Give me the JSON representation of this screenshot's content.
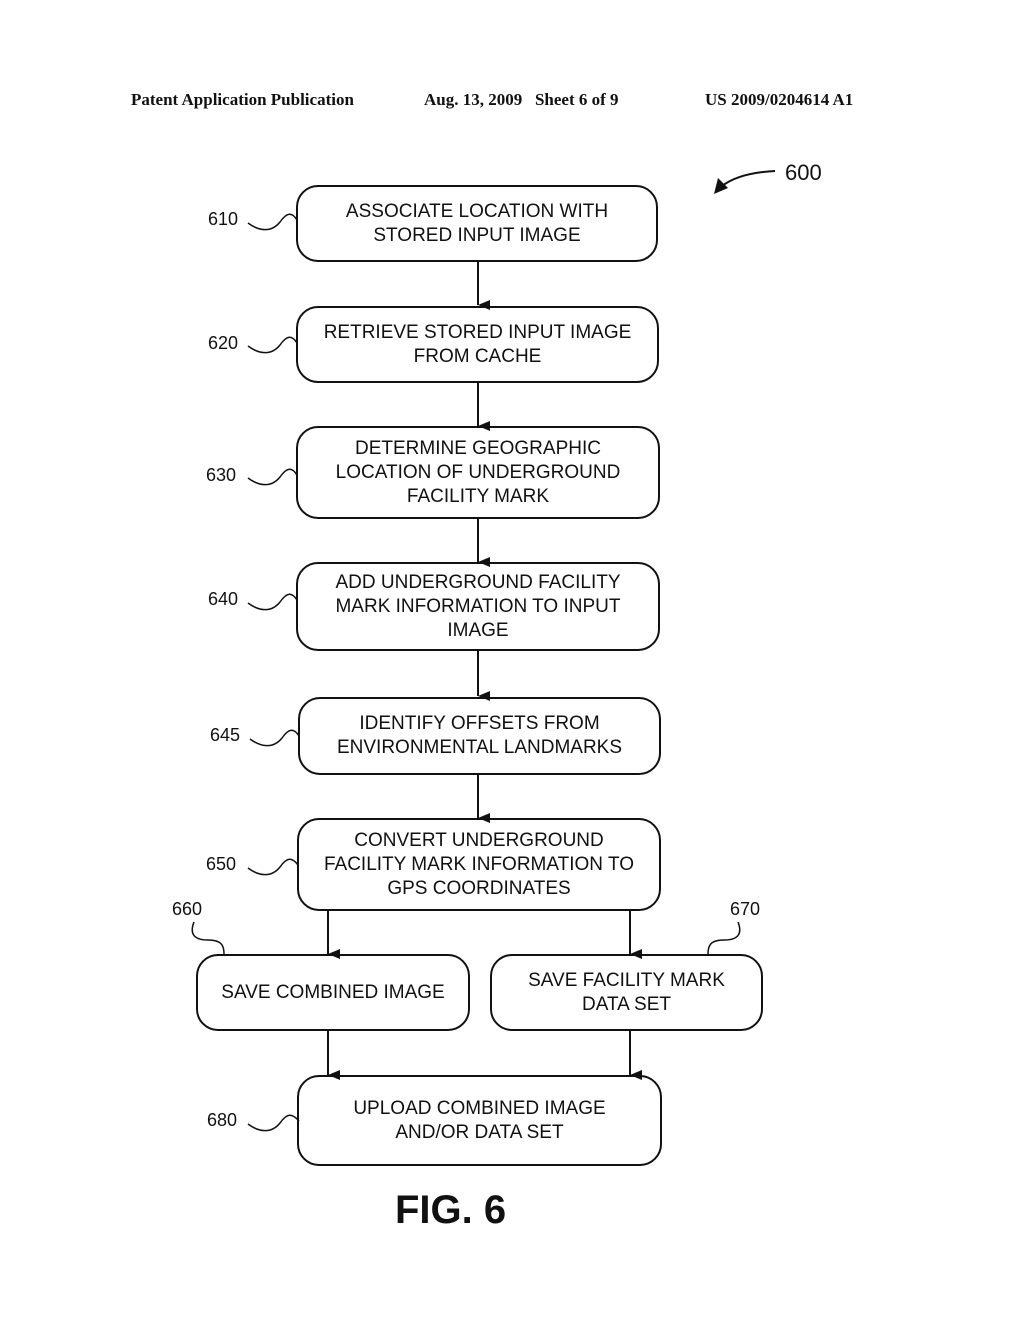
{
  "header": {
    "left": "Patent Application Publication",
    "middle": "Aug. 13, 2009   Sheet 6 of 9",
    "right": "US 2009/0204614 A1"
  },
  "figure": {
    "ref": "600",
    "caption": "FIG. 6"
  },
  "steps": [
    {
      "ref": "610",
      "text": "ASSOCIATE LOCATION WITH\nSTORED INPUT IMAGE"
    },
    {
      "ref": "620",
      "text": "RETRIEVE STORED INPUT IMAGE\nFROM CACHE"
    },
    {
      "ref": "630",
      "text": "DETERMINE GEOGRAPHIC\nLOCATION OF UNDERGROUND\nFACILITY MARK"
    },
    {
      "ref": "640",
      "text": "ADD UNDERGROUND FACILITY\nMARK INFORMATION TO INPUT\nIMAGE"
    },
    {
      "ref": "645",
      "text": "IDENTIFY OFFSETS FROM\nENVIRONMENTAL LANDMARKS"
    },
    {
      "ref": "650",
      "text": "CONVERT UNDERGROUND\nFACILITY MARK INFORMATION TO\nGPS COORDINATES"
    },
    {
      "ref": "660",
      "text": "SAVE COMBINED IMAGE"
    },
    {
      "ref": "670",
      "text": "SAVE FACILITY MARK\nDATA SET"
    },
    {
      "ref": "680",
      "text": "UPLOAD COMBINED IMAGE\nAND/OR DATA SET"
    }
  ]
}
